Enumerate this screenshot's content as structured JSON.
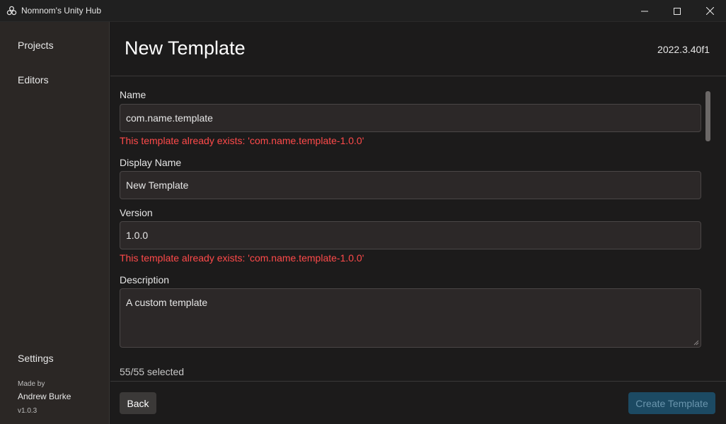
{
  "window": {
    "title": "Nomnom's Unity Hub",
    "app_icon": "unity-cube-icon",
    "controls": [
      "minimize-icon",
      "maximize-icon",
      "close-icon"
    ]
  },
  "sidebar": {
    "items": [
      {
        "label": "Projects"
      },
      {
        "label": "Editors"
      }
    ],
    "settings_label": "Settings",
    "made_by_label": "Made by",
    "author": "Andrew Burke",
    "version": "v1.0.3"
  },
  "header": {
    "title": "New Template",
    "editor_version": "2022.3.40f1"
  },
  "form": {
    "name": {
      "label": "Name",
      "value": "com.name.template",
      "error": "This template already exists: 'com.name.template-1.0.0'"
    },
    "display_name": {
      "label": "Display Name",
      "value": "New Template"
    },
    "version": {
      "label": "Version",
      "value": "1.0.0",
      "error": "This template already exists: 'com.name.template-1.0.0'"
    },
    "description": {
      "label": "Description",
      "value": "A custom template"
    },
    "selected_count": "55/55 selected"
  },
  "footer": {
    "back_label": "Back",
    "create_label": "Create Template"
  },
  "colors": {
    "error": "#ff4a4a",
    "primary_button": "#1c4a63",
    "sidebar_bg": "#2b2725"
  }
}
